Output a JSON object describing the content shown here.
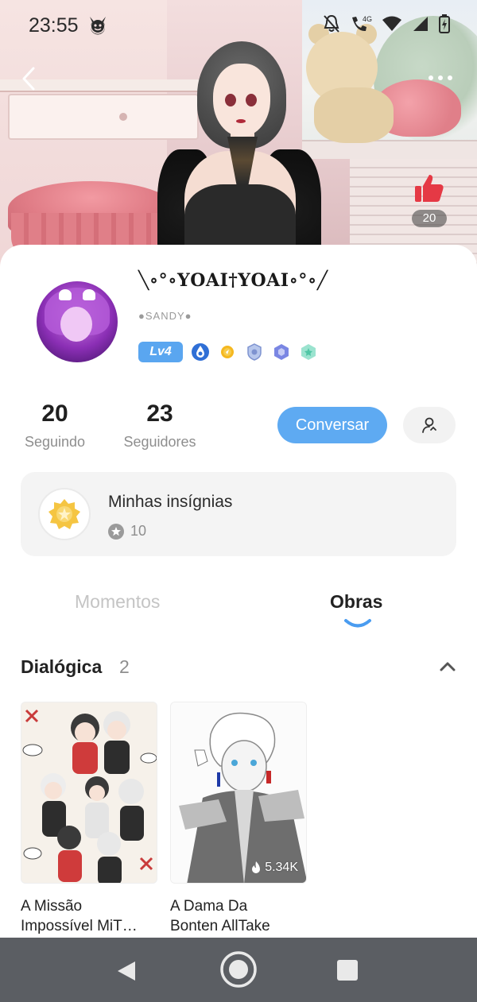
{
  "status_bar": {
    "time": "23:55",
    "network": "4G"
  },
  "header": {
    "likes": "20"
  },
  "profile": {
    "username": "╲∘°∘YOAI†YOAI∘°∘╱",
    "handle": "●SANDY●",
    "level": "Lv4",
    "badge_icons": [
      "drop-badge-icon",
      "coin-badge-icon",
      "shield-badge-icon",
      "hex-badge-icon",
      "star-badge-icon"
    ]
  },
  "stats": {
    "following_count": "20",
    "following_label": "Seguindo",
    "followers_count": "23",
    "followers_label": "Seguidores"
  },
  "actions": {
    "chat_label": "Conversar"
  },
  "insignias": {
    "title": "Minhas insígnias",
    "count": "10"
  },
  "tabs": [
    {
      "label": "Momentos",
      "active": false
    },
    {
      "label": "Obras",
      "active": true
    }
  ],
  "section": {
    "title": "Dialógica",
    "count": "2"
  },
  "works": [
    {
      "title_line1": "A Missão",
      "title_line2": "Impossível MiT…",
      "views": ""
    },
    {
      "title_line1": "A Dama Da",
      "title_line2": "Bonten AllTake",
      "views": "5.34K"
    }
  ],
  "colors": {
    "accent": "#5eaaf2",
    "like": "#e53945",
    "nav_bar": "#5b5e63",
    "level_badge": "#5aa6f0"
  }
}
